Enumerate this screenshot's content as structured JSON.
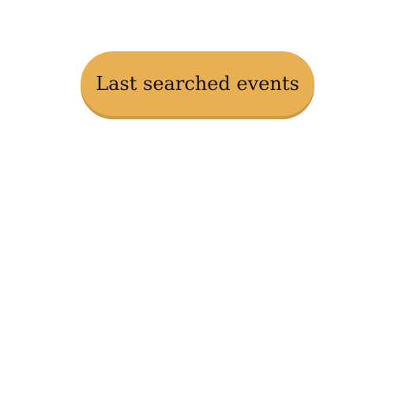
{
  "button": {
    "label": "Last searched events",
    "color": "#e8b052",
    "shadow_color": "#c99a48"
  }
}
